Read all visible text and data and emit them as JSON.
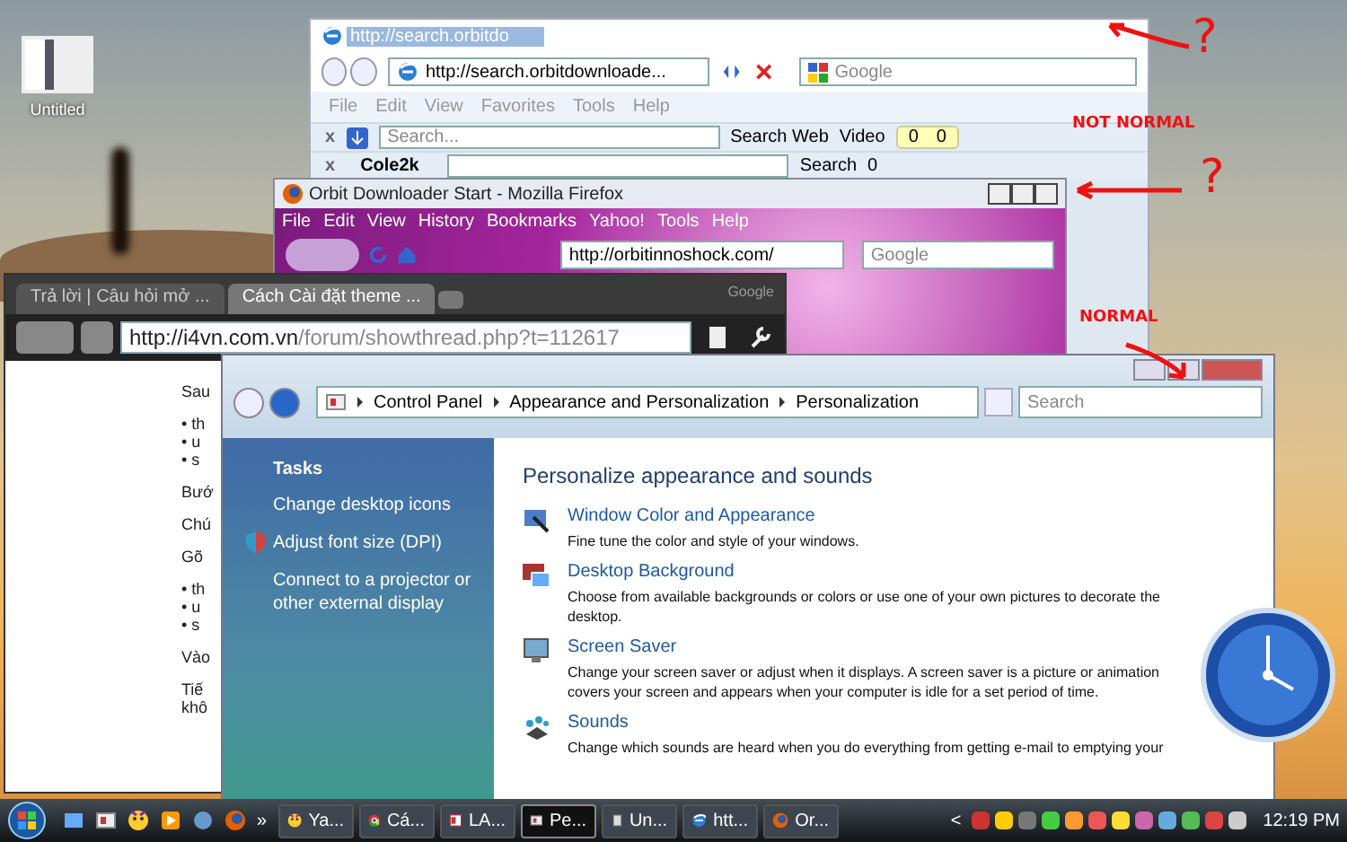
{
  "desktop": {
    "icons": [
      {
        "label": "Untitled"
      }
    ]
  },
  "ie_window": {
    "title": "http://search.orbitdo",
    "address": "http://search.orbitdownloade...",
    "search_placeholder": "Google",
    "menu": [
      "File",
      "Edit",
      "View",
      "Favorites",
      "Tools",
      "Help"
    ],
    "toolbar_1": {
      "close": "x",
      "search_placeholder": "Search...",
      "search_web": "Search Web",
      "video": "Video",
      "counters": [
        "0",
        "0"
      ]
    },
    "toolbar_2": {
      "close": "x",
      "brand": "Cole2k",
      "search": "Search",
      "count": "0"
    }
  },
  "firefox_window": {
    "title": "Orbit Downloader Start - Mozilla Firefox",
    "menu": [
      "File",
      "Edit",
      "View",
      "History",
      "Bookmarks",
      "Yahoo!",
      "Tools",
      "Help"
    ],
    "address": "http://orbitinnoshock.com/",
    "search_placeholder": "Google"
  },
  "chrome_window": {
    "brand": "Google",
    "tabs": [
      {
        "label": "Trả lời | Câu hỏi mở ...",
        "selected": false
      },
      {
        "label": "Cách Cài đặt theme ...",
        "selected": true
      }
    ],
    "url_host": "http://i4vn.com.vn",
    "url_path": "/forum/showthread.php?t=112617",
    "page_fragments": [
      [
        "Sau"
      ],
      [
        "• th",
        "• u",
        "• s"
      ],
      [
        "Bướ"
      ],
      [
        "Chú"
      ],
      [
        "Gõ"
      ],
      [
        "• th",
        "• u",
        "• s"
      ],
      [
        "Vào"
      ],
      [
        "Tiế",
        "khô"
      ]
    ]
  },
  "control_panel": {
    "breadcrumb": [
      "Control Panel",
      "Appearance and Personalization",
      "Personalization"
    ],
    "search_placeholder": "Search",
    "tasks_heading": "Tasks",
    "tasks": [
      {
        "label": "Change desktop icons",
        "shield": false
      },
      {
        "label": "Adjust font size (DPI)",
        "shield": true
      },
      {
        "label": "Connect to a projector or other external display",
        "shield": false
      }
    ],
    "heading": "Personalize appearance and sounds",
    "items": [
      {
        "kind": "window-color",
        "title": "Window Color and Appearance",
        "description": [
          "Fine tune the color and style of your windows."
        ]
      },
      {
        "kind": "background",
        "title": "Desktop Background",
        "description": [
          "Choose from available backgrounds or colors or use one of your own pictures to decorate the",
          "desktop."
        ]
      },
      {
        "kind": "screensaver",
        "title": "Screen Saver",
        "description": [
          "Change your screen saver or adjust when it displays. A screen saver is a picture or animation",
          "covers your screen and appears when your computer is idle for a set period of time."
        ]
      },
      {
        "kind": "sounds",
        "title": "Sounds",
        "description": [
          "Change which sounds are heard when you do everything from getting e-mail to emptying your"
        ]
      }
    ]
  },
  "annotations": [
    {
      "kind": "question",
      "text": "?"
    },
    {
      "kind": "label",
      "text": "NOT NORMAL"
    },
    {
      "kind": "question",
      "text": "?"
    },
    {
      "kind": "label",
      "text": "NORMAL"
    }
  ],
  "taskbar": {
    "more": "»",
    "tasks": [
      {
        "kind": "yahoo",
        "label": "Ya...",
        "selected": false
      },
      {
        "kind": "chrome",
        "label": "Cá...",
        "selected": false
      },
      {
        "kind": "app",
        "label": "LA...",
        "selected": false
      },
      {
        "kind": "panel",
        "label": "Pe...",
        "selected": true
      },
      {
        "kind": "doc",
        "label": "Un...",
        "selected": false
      },
      {
        "kind": "ie",
        "label": "htt...",
        "selected": false
      },
      {
        "kind": "firefox",
        "label": "Or...",
        "selected": false
      }
    ],
    "tray_toggle": "<",
    "clock": "12:19 PM"
  }
}
